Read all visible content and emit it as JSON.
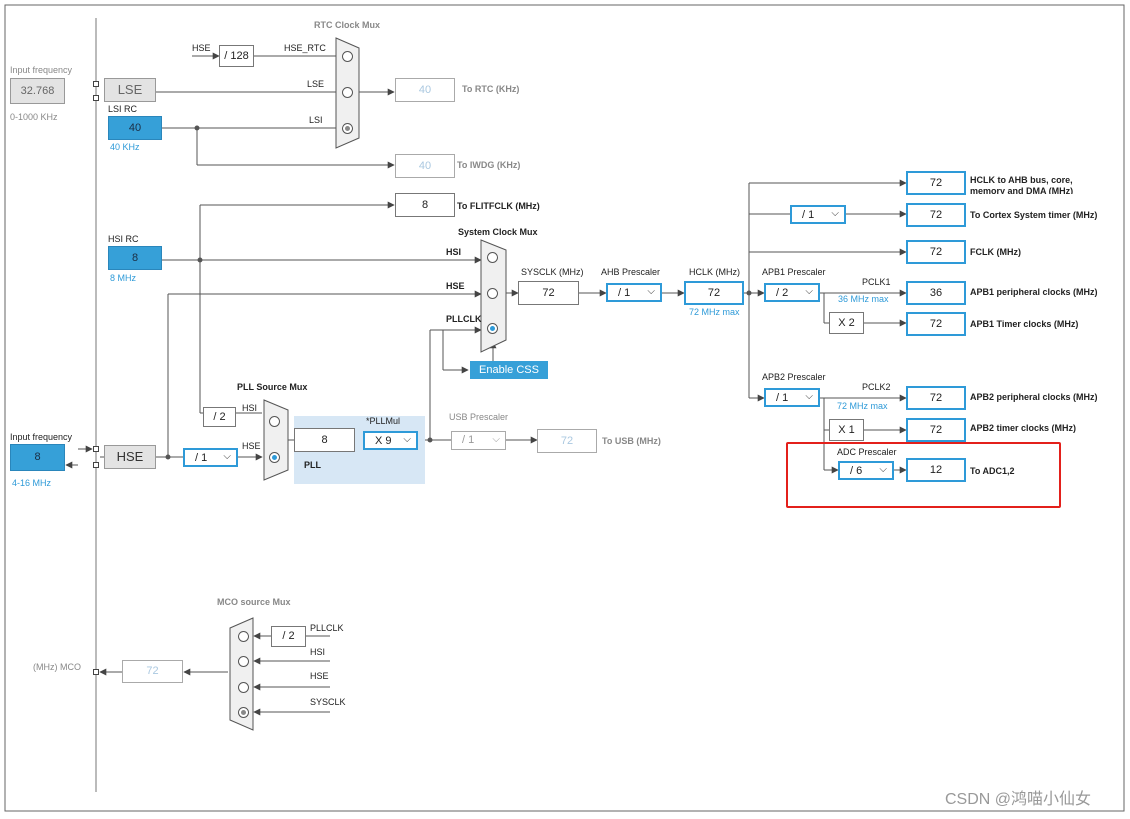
{
  "watermark": "CSDN @鸿喵小仙女",
  "input_lse": {
    "title": "Input frequency",
    "value": "32.768",
    "range": "0-1000 KHz"
  },
  "lse": {
    "label": "LSE"
  },
  "lsi": {
    "title": "LSI RC",
    "value": "40",
    "freq": "40 KHz"
  },
  "rtc_mux": {
    "title": "RTC Clock Mux",
    "hse": "HSE",
    "div128": "/ 128",
    "hse_rtc": "HSE_RTC",
    "lse": "LSE",
    "lsi": "LSI"
  },
  "rtc_out": {
    "value": "40",
    "label": "To RTC (KHz)"
  },
  "iwdg_out": {
    "value": "40",
    "label": "To IWDG (KHz)"
  },
  "flit_out": {
    "value": "8",
    "label": "To FLITFCLK (MHz)"
  },
  "hsi": {
    "title": "HSI RC",
    "value": "8",
    "freq": "8 MHz"
  },
  "sys_mux": {
    "title": "System Clock Mux",
    "hsi": "HSI",
    "hse": "HSE",
    "pllclk": "PLLCLK"
  },
  "enable_css": "Enable CSS",
  "sysclk": {
    "label": "SYSCLK (MHz)",
    "value": "72"
  },
  "ahb": {
    "label": "AHB Prescaler",
    "value": "/ 1"
  },
  "hclk": {
    "label": "HCLK (MHz)",
    "value": "72",
    "max": "72 MHz max"
  },
  "outputs": {
    "hclk_ahb": {
      "value": "72",
      "label": "HCLK to AHB bus, core, memory and DMA (MHz)"
    },
    "cortex_div": "/ 1",
    "cortex": {
      "value": "72",
      "label": "To Cortex System timer (MHz)"
    },
    "fclk": {
      "value": "72",
      "label": "FCLK (MHz)"
    }
  },
  "apb1": {
    "label": "APB1 Prescaler",
    "value": "/ 2",
    "pclk": "PCLK1",
    "max": "36 MHz max",
    "periph_value": "36",
    "periph_label": "APB1 peripheral clocks (MHz)",
    "mult": "X 2",
    "timer_value": "72",
    "timer_label": "APB1 Timer clocks (MHz)"
  },
  "apb2": {
    "label": "APB2 Prescaler",
    "value": "/ 1",
    "pclk": "PCLK2",
    "max": "72 MHz max",
    "periph_value": "72",
    "periph_label": "APB2 peripheral clocks (MHz)",
    "mult": "X 1",
    "timer_value": "72",
    "timer_label": "APB2 timer clocks (MHz)"
  },
  "adc": {
    "label": "ADC Prescaler",
    "value": "/ 6",
    "out_value": "12",
    "out_label": "To ADC1,2"
  },
  "pll_src": {
    "title": "PLL Source Mux",
    "div2": "/ 2",
    "hsi": "HSI",
    "hse": "HSE"
  },
  "pll": {
    "input": "8",
    "mul_label": "*PLLMul",
    "mul": "X 9",
    "label": "PLL"
  },
  "usb": {
    "label": "USB Prescaler",
    "value": "/ 1",
    "out_value": "72",
    "out_label": "To USB (MHz)"
  },
  "hse_in": {
    "title": "Input frequency",
    "value": "8",
    "range": "4-16 MHz",
    "label": "HSE",
    "div": "/ 1"
  },
  "mco": {
    "title": "MCO source Mux",
    "div2": "/ 2",
    "pllclk": "PLLCLK",
    "hsi": "HSI",
    "hse": "HSE",
    "sysclk": "SYSCLK",
    "out_label": "(MHz) MCO",
    "out_value": "72"
  }
}
